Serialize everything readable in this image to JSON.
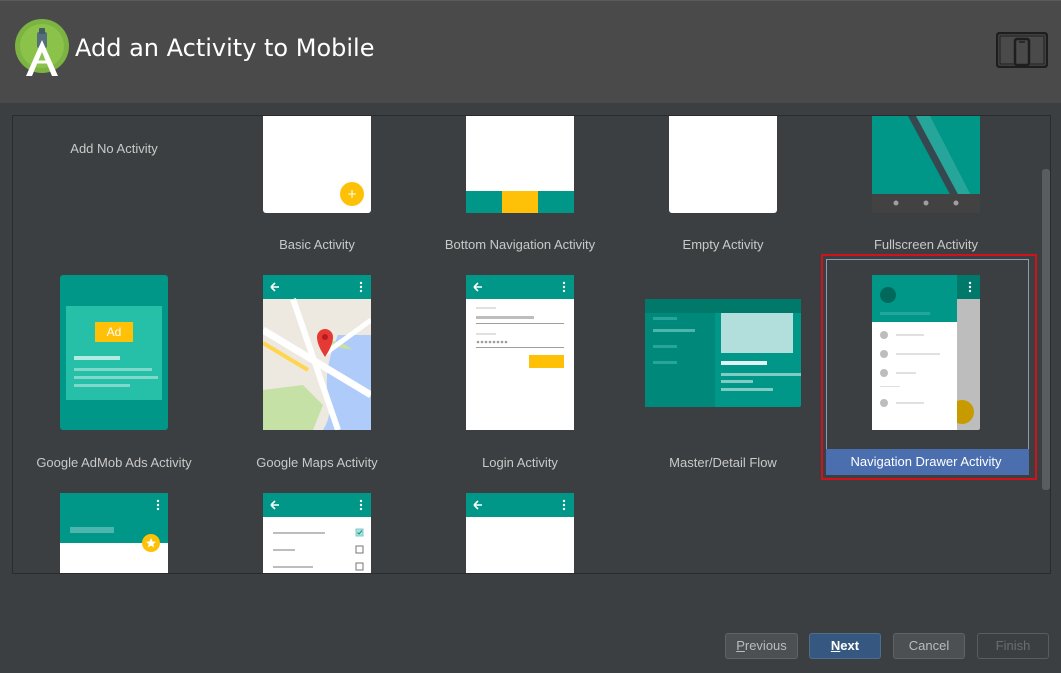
{
  "window": {
    "title": "Add an Activity to Mobile"
  },
  "gallery": {
    "items": [
      {
        "label": "Add No Activity"
      },
      {
        "label": "Basic Activity"
      },
      {
        "label": "Bottom Navigation Activity"
      },
      {
        "label": "Empty Activity"
      },
      {
        "label": "Fullscreen Activity"
      },
      {
        "label": "Google AdMob Ads Activity",
        "ad_badge": "Ad"
      },
      {
        "label": "Google Maps Activity"
      },
      {
        "label": "Login Activity"
      },
      {
        "label": "Master/Detail Flow"
      },
      {
        "label": "Navigation Drawer Activity"
      },
      {
        "label": ""
      },
      {
        "label": ""
      },
      {
        "label": ""
      }
    ],
    "selected": "Navigation Drawer Activity"
  },
  "buttons": {
    "previous": {
      "mnemonic": "P",
      "rest": "revious"
    },
    "next": {
      "mnemonic": "N",
      "rest": "ext"
    },
    "cancel": "Cancel",
    "finish": "Finish"
  },
  "colors": {
    "teal": "#009688",
    "teal_dark": "#00796b",
    "amber": "#ffc107",
    "selection": "#4b6eaf",
    "highlight_outline": "#d0121a"
  },
  "icons": {
    "logo": "android-studio-logo",
    "device": "phone-tablet-icon",
    "fab": "plus-icon",
    "back": "arrow-left-icon",
    "overflow": "more-vert-icon",
    "marker": "map-pin-icon",
    "star": "star-icon"
  }
}
